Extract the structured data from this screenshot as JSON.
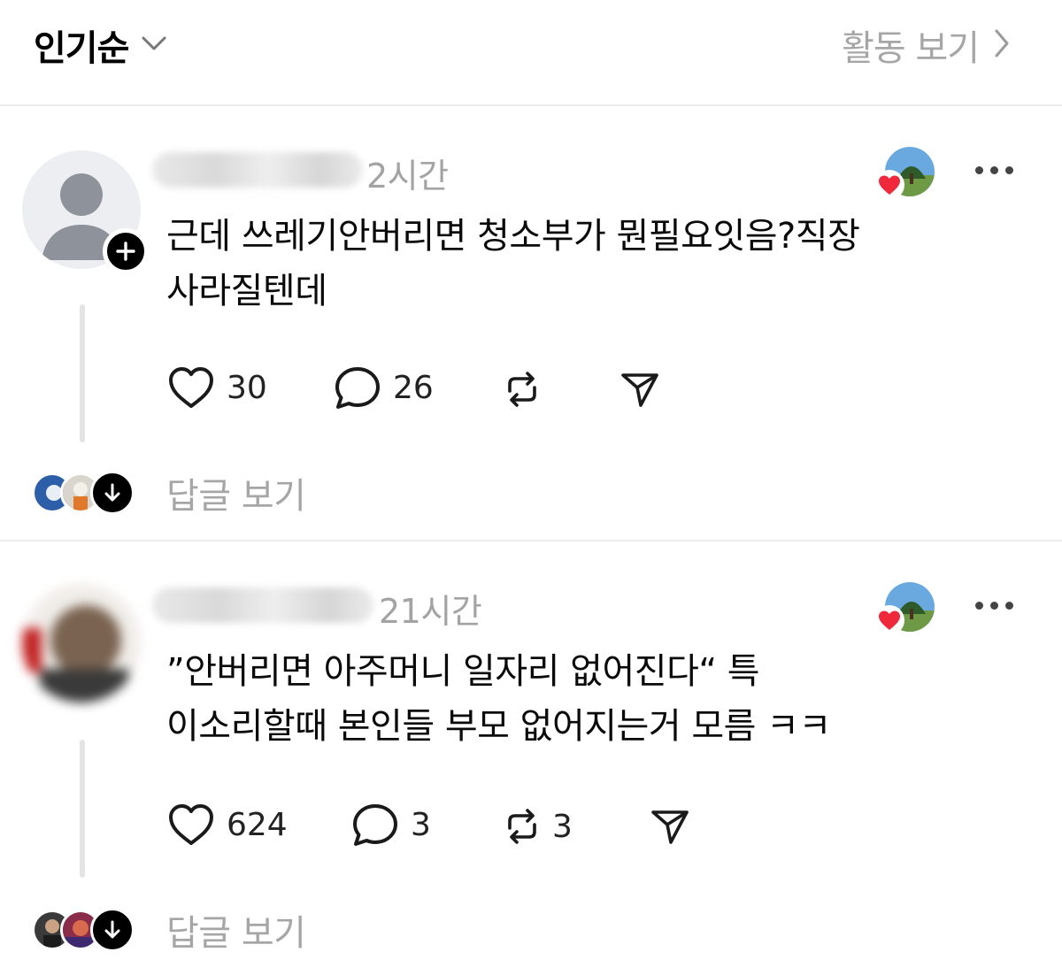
{
  "header": {
    "sort_label": "인기순",
    "activity_label": "활동 보기"
  },
  "posts": [
    {
      "time": "2시간",
      "text_line1": "근데 쓰레기안버리면 청소부가 뭔필요잇음?직장",
      "text_line2": "사라질텐데",
      "like_count": "30",
      "comment_count": "26",
      "repost_count": "",
      "view_replies": "답글 보기"
    },
    {
      "time": "21시간",
      "text_line1": "”안버리면 아주머니 일자리 없어진다“ 특",
      "text_line2": "이소리할때 본인들 부모 없어지는거 모름 ㅋㅋ",
      "like_count": "624",
      "comment_count": "3",
      "repost_count": "3",
      "view_replies": "답글 보기"
    }
  ],
  "icons": {
    "sort": "chevron-down-icon",
    "activity": "chevron-right-icon",
    "like": "heart-icon",
    "comment": "comment-bubble-icon",
    "repost": "repost-icon",
    "share": "send-icon",
    "more": "more-icon"
  },
  "colors": {
    "heart_red": "#f0283c",
    "muted_text": "#a6a6a6"
  }
}
